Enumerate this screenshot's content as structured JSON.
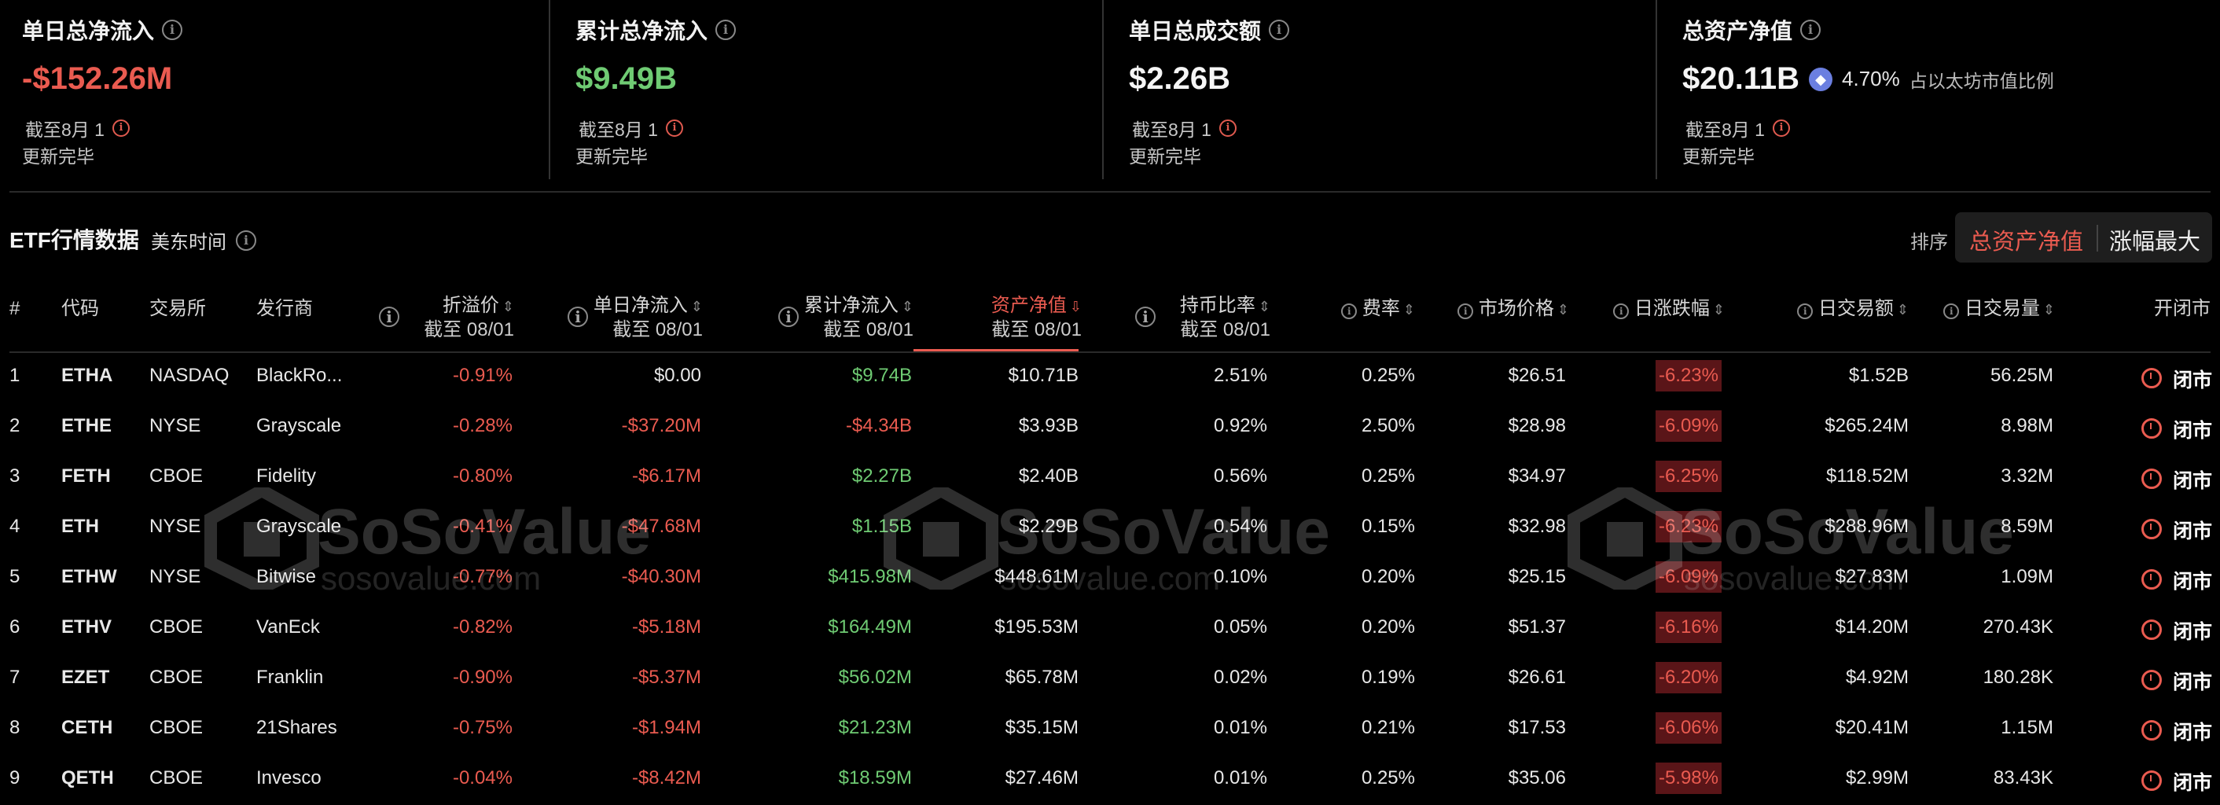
{
  "stats": [
    {
      "title": "单日总净流入",
      "value": "-$152.26M",
      "date": "截至8月 1",
      "status": "更新完毕"
    },
    {
      "title": "累计总净流入",
      "value": "$9.49B",
      "date": "截至8月 1",
      "status": "更新完毕"
    },
    {
      "title": "单日总成交额",
      "value": "$2.26B",
      "date": "截至8月 1",
      "status": "更新完毕"
    },
    {
      "title": "总资产净值",
      "value": "$20.11B",
      "eth_pct": "4.70%",
      "eth_note": "占以太坊市值比例",
      "date": "截至8月 1",
      "status": "更新完毕"
    }
  ],
  "section": {
    "title": "ETF行情数据",
    "timezone": "美东时间"
  },
  "sort": {
    "label": "排序",
    "options": [
      "总资产净值",
      "涨幅最大"
    ],
    "active": "总资产净值"
  },
  "columns": {
    "num": "#",
    "code": "代码",
    "exchange": "交易所",
    "issuer": "发行商",
    "premium": "折溢价",
    "daily_inflow": "单日净流入",
    "cum_inflow": "累计净流入",
    "nav": "资产净值",
    "holding": "持币比率",
    "fee": "费率",
    "price": "市场价格",
    "change": "日涨跌幅",
    "volume_usd": "日交易额",
    "volume_shares": "日交易量",
    "status": "开闭市",
    "as_of": "截至 08/01"
  },
  "rows": [
    {
      "num": "1",
      "code": "ETHA",
      "exchange": "NASDAQ",
      "issuer": "BlackRo...",
      "premium": "-0.91%",
      "daily_inflow": "$0.00",
      "cum_inflow": "$9.74B",
      "nav": "$10.71B",
      "holding": "2.51%",
      "fee": "0.25%",
      "price": "$26.51",
      "change": "-6.23%",
      "volume_usd": "$1.52B",
      "volume_shares": "56.25M",
      "status": "闭市"
    },
    {
      "num": "2",
      "code": "ETHE",
      "exchange": "NYSE",
      "issuer": "Grayscale",
      "premium": "-0.28%",
      "daily_inflow": "-$37.20M",
      "cum_inflow": "-$4.34B",
      "nav": "$3.93B",
      "holding": "0.92%",
      "fee": "2.50%",
      "price": "$28.98",
      "change": "-6.09%",
      "volume_usd": "$265.24M",
      "volume_shares": "8.98M",
      "status": "闭市"
    },
    {
      "num": "3",
      "code": "FETH",
      "exchange": "CBOE",
      "issuer": "Fidelity",
      "premium": "-0.80%",
      "daily_inflow": "-$6.17M",
      "cum_inflow": "$2.27B",
      "nav": "$2.40B",
      "holding": "0.56%",
      "fee": "0.25%",
      "price": "$34.97",
      "change": "-6.25%",
      "volume_usd": "$118.52M",
      "volume_shares": "3.32M",
      "status": "闭市"
    },
    {
      "num": "4",
      "code": "ETH",
      "exchange": "NYSE",
      "issuer": "Grayscale",
      "premium": "-0.41%",
      "daily_inflow": "-$47.68M",
      "cum_inflow": "$1.15B",
      "nav": "$2.29B",
      "holding": "0.54%",
      "fee": "0.15%",
      "price": "$32.98",
      "change": "-6.23%",
      "volume_usd": "$288.96M",
      "volume_shares": "8.59M",
      "status": "闭市"
    },
    {
      "num": "5",
      "code": "ETHW",
      "exchange": "NYSE",
      "issuer": "Bitwise",
      "premium": "-0.77%",
      "daily_inflow": "-$40.30M",
      "cum_inflow": "$415.98M",
      "nav": "$448.61M",
      "holding": "0.10%",
      "fee": "0.20%",
      "price": "$25.15",
      "change": "-6.09%",
      "volume_usd": "$27.83M",
      "volume_shares": "1.09M",
      "status": "闭市"
    },
    {
      "num": "6",
      "code": "ETHV",
      "exchange": "CBOE",
      "issuer": "VanEck",
      "premium": "-0.82%",
      "daily_inflow": "-$5.18M",
      "cum_inflow": "$164.49M",
      "nav": "$195.53M",
      "holding": "0.05%",
      "fee": "0.20%",
      "price": "$51.37",
      "change": "-6.16%",
      "volume_usd": "$14.20M",
      "volume_shares": "270.43K",
      "status": "闭市"
    },
    {
      "num": "7",
      "code": "EZET",
      "exchange": "CBOE",
      "issuer": "Franklin",
      "premium": "-0.90%",
      "daily_inflow": "-$5.37M",
      "cum_inflow": "$56.02M",
      "nav": "$65.78M",
      "holding": "0.02%",
      "fee": "0.19%",
      "price": "$26.61",
      "change": "-6.20%",
      "volume_usd": "$4.92M",
      "volume_shares": "180.28K",
      "status": "闭市"
    },
    {
      "num": "8",
      "code": "CETH",
      "exchange": "CBOE",
      "issuer": "21Shares",
      "premium": "-0.75%",
      "daily_inflow": "-$1.94M",
      "cum_inflow": "$21.23M",
      "nav": "$35.15M",
      "holding": "0.01%",
      "fee": "0.21%",
      "price": "$17.53",
      "change": "-6.06%",
      "volume_usd": "$20.41M",
      "volume_shares": "1.15M",
      "status": "闭市"
    },
    {
      "num": "9",
      "code": "QETH",
      "exchange": "CBOE",
      "issuer": "Invesco",
      "premium": "-0.04%",
      "daily_inflow": "-$8.42M",
      "cum_inflow": "$18.59M",
      "nav": "$27.46M",
      "holding": "0.01%",
      "fee": "0.25%",
      "price": "$35.06",
      "change": "-5.98%",
      "volume_usd": "$2.99M",
      "volume_shares": "83.43K",
      "status": "闭市"
    }
  ],
  "watermark": {
    "name": "SoSoValue",
    "url": "sosovalue.com"
  },
  "colors": {
    "negative": "#ea5b50",
    "positive": "#6fcb73",
    "background": "#000000"
  }
}
